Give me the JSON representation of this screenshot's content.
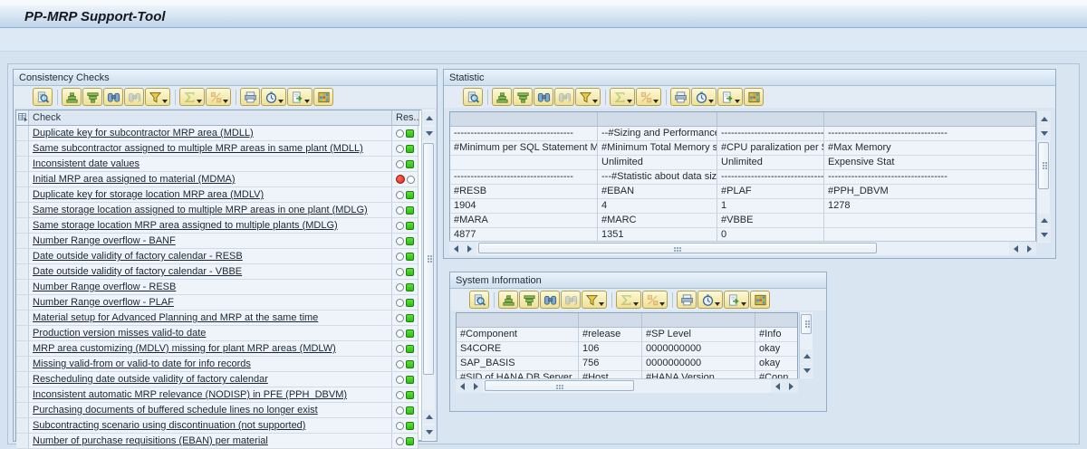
{
  "app": {
    "title": "PP-MRP Support-Tool"
  },
  "colors": {
    "title_band": "#bed4ea",
    "panel_bg": "#d9e5f1",
    "toolbar_button_bg": "#f5e9a8",
    "status_green": "#2dbf14",
    "status_red": "#dc2812",
    "link_text": "#1b2733"
  },
  "toolbar": {
    "buttons": [
      {
        "name": "details",
        "icon": "magnifier-icon",
        "enabled": true,
        "dropdown": false,
        "sep_after": true
      },
      {
        "name": "sort-ascending",
        "icon": "sort-ascending-icon",
        "enabled": true,
        "dropdown": false,
        "sep_after": false
      },
      {
        "name": "sort-descending",
        "icon": "sort-descending-icon",
        "enabled": true,
        "dropdown": false,
        "sep_after": false
      },
      {
        "name": "find",
        "icon": "binoculars-icon",
        "enabled": true,
        "dropdown": false,
        "sep_after": false
      },
      {
        "name": "find-next",
        "icon": "binoculars-next-icon",
        "enabled": false,
        "dropdown": false,
        "sep_after": false
      },
      {
        "name": "set-filter",
        "icon": "funnel-icon",
        "enabled": true,
        "dropdown": true,
        "sep_after": true
      },
      {
        "name": "total",
        "icon": "sigma-icon",
        "enabled": false,
        "dropdown": true,
        "sep_after": false
      },
      {
        "name": "subtotal",
        "icon": "subtotal-icon",
        "enabled": false,
        "dropdown": true,
        "sep_after": true
      },
      {
        "name": "print",
        "icon": "printer-icon",
        "enabled": true,
        "dropdown": false,
        "sep_after": false
      },
      {
        "name": "views",
        "icon": "views-clock-icon",
        "enabled": true,
        "dropdown": true,
        "sep_after": false
      },
      {
        "name": "export",
        "icon": "export-icon",
        "enabled": true,
        "dropdown": true,
        "sep_after": false
      },
      {
        "name": "choose-layout",
        "icon": "layout-grid-icon",
        "enabled": true,
        "dropdown": false,
        "sep_after": false
      }
    ]
  },
  "consistency_checks": {
    "title": "Consistency Checks",
    "columns": {
      "check": "Check",
      "result": "Res..."
    },
    "rows": [
      {
        "label": "Duplicate key for subcontractor MRP area (MDLL)",
        "status": "green"
      },
      {
        "label": "Same subcontractor assigned to multiple MRP areas in same plant (MDLL)",
        "status": "green"
      },
      {
        "label": "Inconsistent date values",
        "status": "green"
      },
      {
        "label": "Initial MRP area assigned to material (MDMA)",
        "status": "red"
      },
      {
        "label": "Duplicate key for storage location MRP area (MDLV)",
        "status": "green"
      },
      {
        "label": "Same storage location assigned to multiple MRP areas in one plant (MDLG)",
        "status": "green"
      },
      {
        "label": "Same storage location MRP area assigned to multiple plants (MDLG)",
        "status": "green"
      },
      {
        "label": "Number Range overflow - BANF",
        "status": "green"
      },
      {
        "label": "Date outside validity of factory calendar - RESB",
        "status": "green"
      },
      {
        "label": "Date outside validity of factory calendar - VBBE",
        "status": "green"
      },
      {
        "label": "Number Range overflow - RESB",
        "status": "green"
      },
      {
        "label": "Number Range overflow - PLAF",
        "status": "green"
      },
      {
        "label": "Material setup for Advanced Planning and MRP at the same time",
        "status": "green"
      },
      {
        "label": "Production version misses valid-to date",
        "status": "green"
      },
      {
        "label": "MRP area customizing (MDLV) missing for plant MRP areas (MDLW)",
        "status": "green"
      },
      {
        "label": "Missing valid-from or valid-to date for info records",
        "status": "green"
      },
      {
        "label": "Rescheduling date outside validity of factory calendar",
        "status": "green"
      },
      {
        "label": "Inconsistent automatic MRP relevance (NODISP) in PFE (PPH_DBVM)",
        "status": "green"
      },
      {
        "label": "Purchasing documents of buffered schedule lines no longer exist",
        "status": "green"
      },
      {
        "label": "Subcontracting scenario using discontinuation (not supported)",
        "status": "green"
      },
      {
        "label": "Number of purchase requisitions (EBAN) per material",
        "status": "green"
      }
    ]
  },
  "statistic": {
    "title": "Statistic",
    "rows": [
      [
        "------------------------------------",
        "--#Sizing and Performance(PoC)#--",
        "------------------------------------",
        "------------------------------------"
      ],
      [
        "#Minimum per SQL Statement Memory Limit",
        "#Minimum Total Memory size limit",
        "#CPU paralization per SQL task",
        "#Max Memory"
      ],
      [
        "",
        "Unlimited",
        "Unlimited",
        "Expensive Stat"
      ],
      [
        "------------------------------------",
        "---#Statistic about data size#---",
        "------------------------------------",
        "------------------------------------"
      ],
      [
        "#RESB",
        "#EBAN",
        "#PLAF",
        "#PPH_DBVM"
      ],
      [
        "1904",
        "4",
        "1",
        "1278"
      ],
      [
        "#MARA",
        "#MARC",
        "#VBBE",
        ""
      ],
      [
        "4877",
        "1351",
        "0",
        ""
      ]
    ]
  },
  "system_information": {
    "title": "System Information",
    "rows": [
      [
        "#Component",
        "#release",
        "#SP Level",
        "#Info"
      ],
      [
        "S4CORE",
        "106",
        "0000000000",
        "okay"
      ],
      [
        "SAP_BASIS",
        "756",
        "0000000000",
        "okay"
      ],
      [
        "#SID of HANA DB Server",
        "#Host",
        "#HANA Version",
        "#Conn"
      ]
    ]
  }
}
